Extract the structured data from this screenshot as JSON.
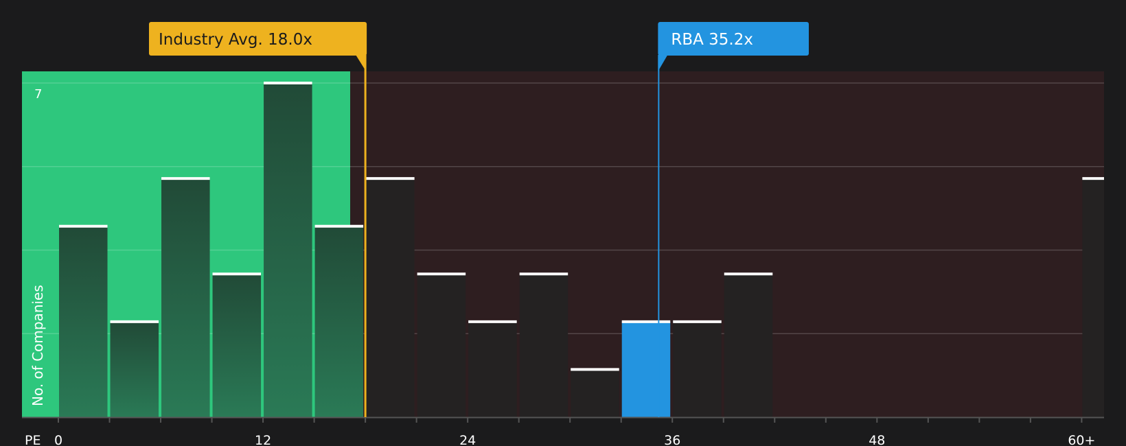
{
  "chart_data": {
    "type": "bar",
    "xlabel": "PE",
    "ylabel": "No. of Companies",
    "y_max_label": "7",
    "ylim": [
      0,
      7
    ],
    "x_ticks": [
      {
        "value": 0,
        "label": "0"
      },
      {
        "value": 12,
        "label": "12"
      },
      {
        "value": 24,
        "label": "24"
      },
      {
        "value": 36,
        "label": "36"
      },
      {
        "value": 48,
        "label": "48"
      },
      {
        "value": 60,
        "label": "60+"
      }
    ],
    "bin_width": 3,
    "bars": [
      {
        "x": 0,
        "value": 4
      },
      {
        "x": 3,
        "value": 2
      },
      {
        "x": 6,
        "value": 5
      },
      {
        "x": 9,
        "value": 3
      },
      {
        "x": 12,
        "value": 7
      },
      {
        "x": 15,
        "value": 4
      },
      {
        "x": 18,
        "value": 5
      },
      {
        "x": 21,
        "value": 3
      },
      {
        "x": 24,
        "value": 2
      },
      {
        "x": 27,
        "value": 3
      },
      {
        "x": 30,
        "value": 1
      },
      {
        "x": 33,
        "value": 2,
        "highlight": true
      },
      {
        "x": 36,
        "value": 2
      },
      {
        "x": 39,
        "value": 3
      },
      {
        "x": 60,
        "value": 5
      }
    ],
    "markers": {
      "industry": {
        "label": "Industry Avg. 18.0x",
        "value": 18.0
      },
      "company": {
        "label": "RBA 35.2x",
        "value": 35.2
      }
    },
    "grid": true,
    "colors": {
      "background": "#1b1b1c",
      "good_zone": "#2ec77d",
      "bad_zone": "#2e1e20",
      "bar_good": "#234d3a",
      "bar_bad": "#242222",
      "bar_highlight": "#2394e0",
      "industry": "#eeb21f",
      "company": "#2394e0"
    }
  }
}
